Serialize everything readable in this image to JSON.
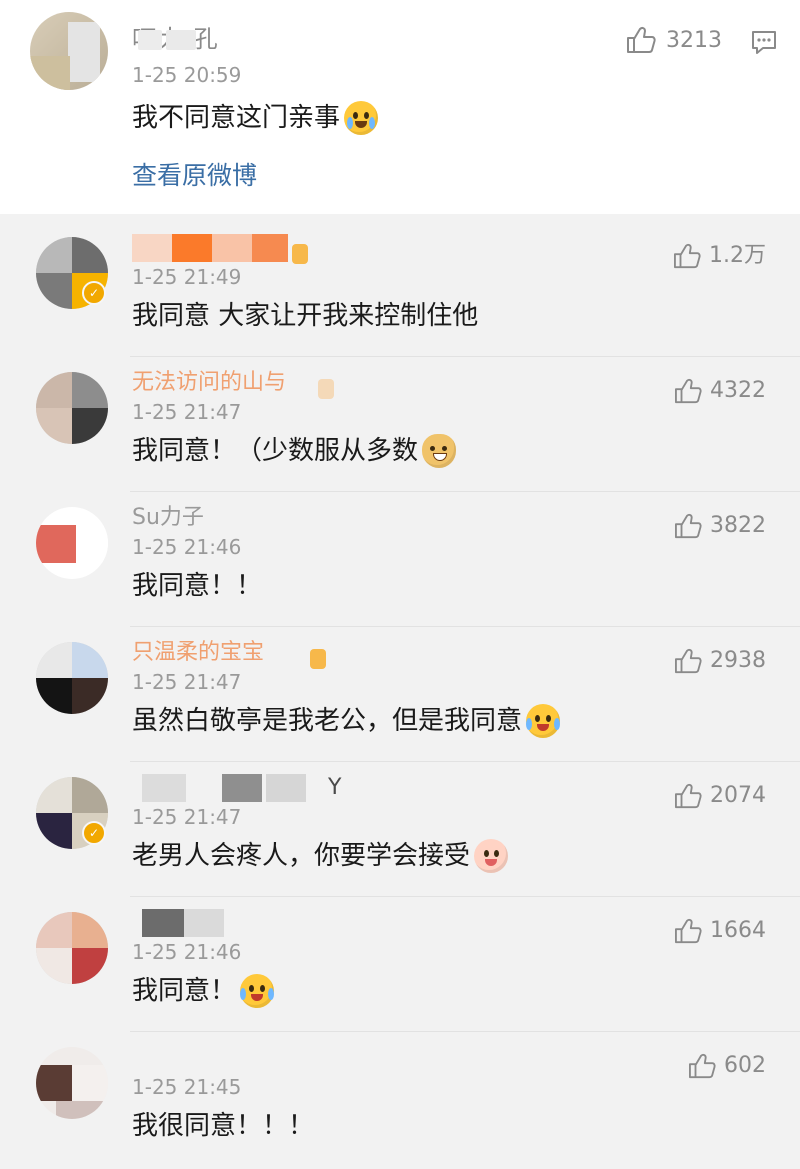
{
  "main_post": {
    "user_name": "呵大 孔",
    "time": "1-25 20:59",
    "text": "我不同意这门亲事",
    "emoji": "crying-face-emoji",
    "view_original": "查看原微博",
    "likes": "3213"
  },
  "replies": [
    {
      "name": "",
      "time": "1-25 21:49",
      "text": "我同意 大家让开我来控制住他",
      "emoji": "",
      "likes": "1.2万"
    },
    {
      "name": "无法访问的山与",
      "time": "1-25 21:47",
      "text": "我同意！（少数服从多数",
      "emoji": "doge-emoji",
      "likes": "4322"
    },
    {
      "name": "Su力子",
      "time": "1-25 21:46",
      "text": "我同意！！",
      "emoji": "",
      "likes": "3822"
    },
    {
      "name": "只温柔的宝宝",
      "time": "1-25 21:47",
      "text": "虽然白敬亭是我老公，但是我同意",
      "emoji": "crying-smile-emoji",
      "likes": "2938"
    },
    {
      "name": "Y",
      "time": "1-25 21:47",
      "text": "老男人会疼人，你要学会接受",
      "emoji": "dragon-emoji",
      "likes": "2074"
    },
    {
      "name": "",
      "time": "1-25 21:46",
      "text": "我同意！",
      "emoji": "crying-smile-emoji",
      "likes": "1664"
    },
    {
      "name": "",
      "time": "1-25 21:45",
      "text": "我很同意！！！",
      "emoji": "",
      "likes": "602"
    }
  ],
  "colors": {
    "link": "#3a6ea5",
    "username": "#f0a070",
    "meta": "#9a9a9a",
    "background": "#f2f2f2"
  }
}
